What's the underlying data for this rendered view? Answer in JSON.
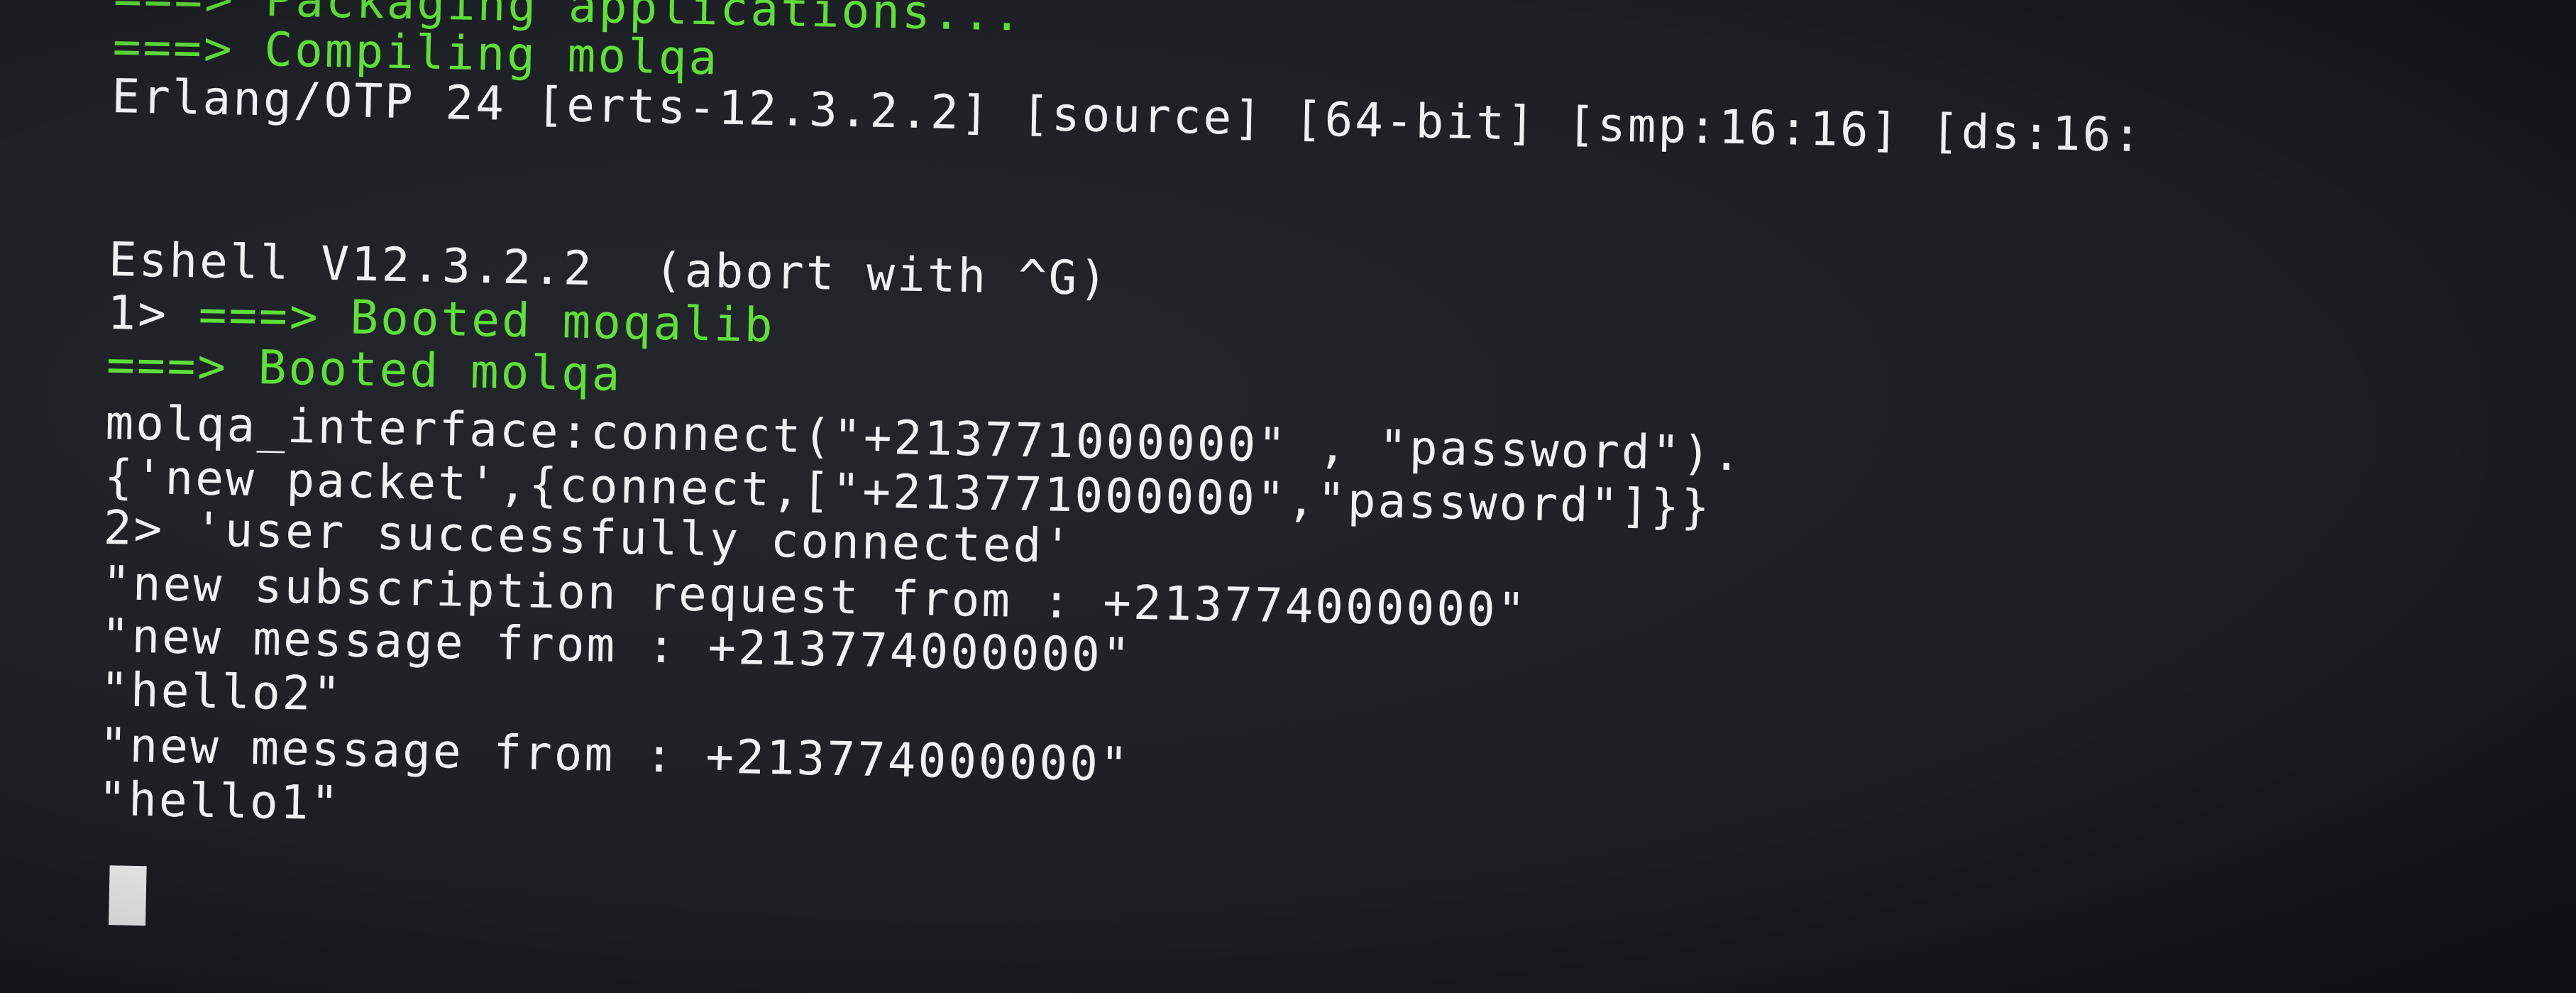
{
  "terminal": {
    "lines": [
      {
        "text": "===> Packaging applications...",
        "color": "#5fdf3a"
      },
      {
        "text": "===> Compiling molqa",
        "color": "#5fdf3a"
      },
      {
        "text": "Erlang/OTP 24 [erts-12.3.2.2] [source] [64-bit] [smp:16:16] [ds:16:",
        "color": "#eef0f2"
      },
      {
        "text": "Eshell V12.3.2.2  (abort with ^G)",
        "color": "#eef0f2"
      },
      {
        "prompt": "1> ",
        "text": "===> Booted moqalib",
        "color": "#5fdf3a"
      },
      {
        "text": "===> Booted molqa",
        "color": "#5fdf3a"
      },
      {
        "text": "molqa_interface:connect(\"+213771000000\" , \"password\").",
        "color": "#eef0f2"
      },
      {
        "text": "{'new packet',{connect,[\"+213771000000\",\"password\"]}}",
        "color": "#eef0f2"
      },
      {
        "text": "2> 'user successfully connected'",
        "color": "#eef0f2"
      },
      {
        "text": "\"new subscription request from : +213774000000\"",
        "color": "#eef0f2"
      },
      {
        "text": "\"new message from : +213774000000\"",
        "color": "#eef0f2"
      },
      {
        "text": "\"hello2\"",
        "color": "#eef0f2"
      },
      {
        "text": "\"new message from : +213774000000\"",
        "color": "#eef0f2"
      },
      {
        "text": "\"hello1\"",
        "color": "#eef0f2"
      }
    ]
  },
  "colors": {
    "background": "#1c1f23",
    "output_green": "#5fdf3a",
    "output_white": "#eef0f2",
    "cursor": "#f1f1f1"
  }
}
